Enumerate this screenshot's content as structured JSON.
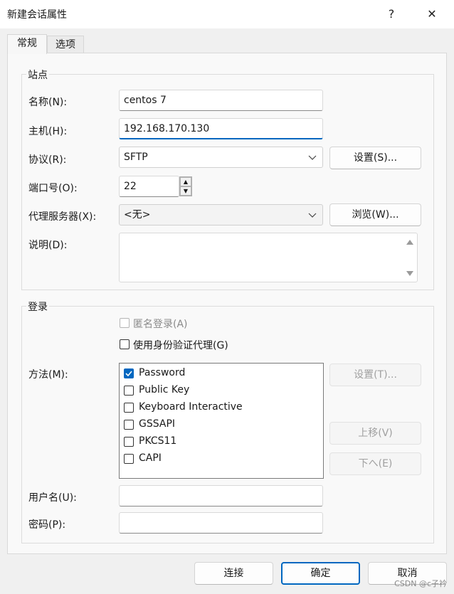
{
  "window": {
    "title": "新建会话属性",
    "help_label": "?",
    "close_label": "✕"
  },
  "tabs": [
    {
      "label": "常规",
      "active": true
    },
    {
      "label": "选项",
      "active": false
    }
  ],
  "site": {
    "group_label": "站点",
    "name_label": "名称(N):",
    "name_value": "centos 7",
    "host_label": "主机(H):",
    "host_value": "192.168.170.130",
    "protocol_label": "协议(R):",
    "protocol_value": "SFTP",
    "protocol_settings_label": "设置(S)...",
    "port_label": "端口号(O):",
    "port_value": "22",
    "proxy_label": "代理服务器(X):",
    "proxy_value": "<无>",
    "browse_label": "浏览(W)...",
    "description_label": "说明(D):",
    "description_value": ""
  },
  "login": {
    "group_label": "登录",
    "anonymous_label": "匿名登录(A)",
    "anonymous_checked": false,
    "agent_label": "使用身份验证代理(G)",
    "agent_checked": false,
    "method_label": "方法(M):",
    "methods": [
      {
        "label": "Password",
        "checked": true
      },
      {
        "label": "Public Key",
        "checked": false
      },
      {
        "label": "Keyboard Interactive",
        "checked": false
      },
      {
        "label": "GSSAPI",
        "checked": false
      },
      {
        "label": "PKCS11",
        "checked": false
      },
      {
        "label": "CAPI",
        "checked": false
      }
    ],
    "method_settings_label": "设置(T)...",
    "move_up_label": "上移(V)",
    "move_down_label": "下へ(E)",
    "username_label": "用户名(U):",
    "username_value": "",
    "password_label": "密码(P):",
    "password_value": ""
  },
  "footer": {
    "connect_label": "连接",
    "ok_label": "确定",
    "cancel_label": "取消"
  },
  "watermark": "CSDN @c子衿",
  "colors": {
    "accent": "#0067c0",
    "window_bg": "#f0f0f0",
    "pane_bg": "#f9f9f9"
  }
}
